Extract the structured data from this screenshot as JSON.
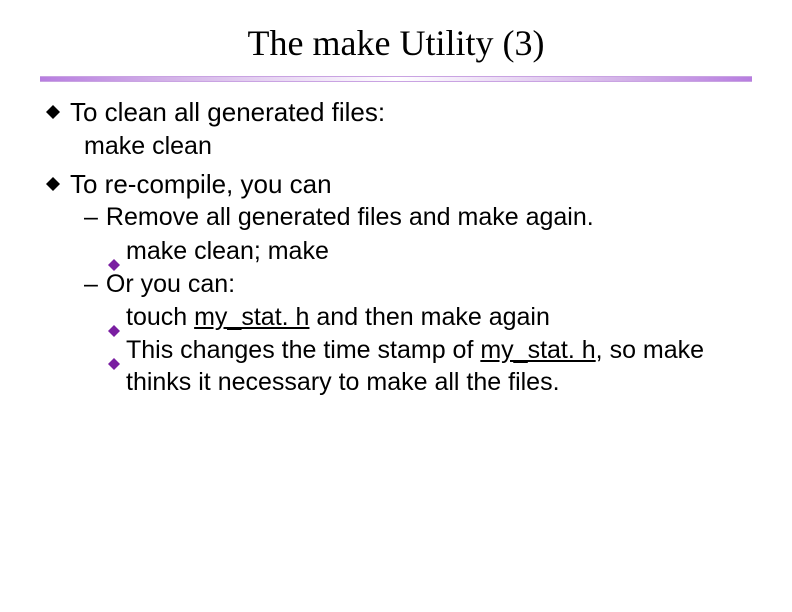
{
  "title": "The make Utility (3)",
  "bullets": {
    "b1": {
      "text": "To clean all generated files:",
      "sub": "make clean"
    },
    "b2": {
      "text": "To re-compile, you can",
      "items": [
        {
          "text": "Remove all generated files and make again.",
          "subitems": [
            {
              "text": "make clean;  make"
            }
          ]
        },
        {
          "text": "Or you can:",
          "subitems": [
            {
              "pre": "touch ",
              "u": "my_stat. h",
              "post": " and then make again"
            },
            {
              "pre": "This changes the time stamp of ",
              "u": "my_stat. h",
              "post": ", so make thinks it necessary to make all the files."
            }
          ]
        }
      ]
    }
  },
  "colors": {
    "accent": "#7a1ea1"
  }
}
